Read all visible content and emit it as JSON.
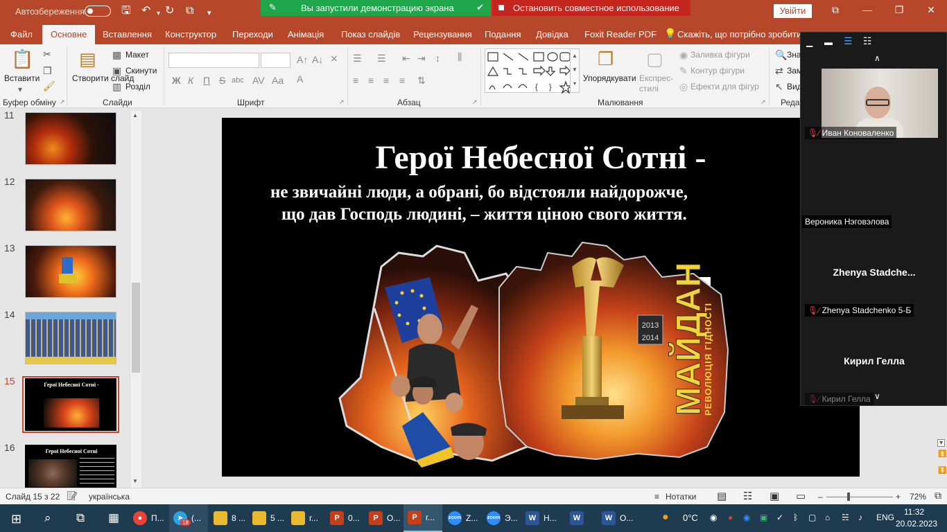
{
  "titlebar": {
    "autosave_label": "Автозбереження",
    "share_banner": "Вы запустили демонстрацию экрана",
    "stop_share": "Остановить совместное использование",
    "signin": "Увійти",
    "accent_color": "#b7472a"
  },
  "tabs": [
    "Файл",
    "Основне",
    "Вставлення",
    "Конструктор",
    "Переходи",
    "Анімація",
    "Показ слайдів",
    "Рецензування",
    "Подання",
    "Довідка",
    "Foxit Reader PDF",
    "Скажіть, що потрібно зробити"
  ],
  "ribbon": {
    "paste": "Вставити",
    "new_slide": "Створити слайд",
    "layout": "Макет",
    "reset": "Скинути",
    "section": "Розділ",
    "arrange": "Упорядкувати",
    "quick_styles": "Експрес-стилі",
    "shape_fill": "Заливка фігури",
    "shape_outline": "Контур фігури",
    "shape_effects": "Ефекти для фігур",
    "find": "Зна",
    "replace": "Зам",
    "select": "Вид",
    "groups": {
      "clipboard": "Буфер обміну",
      "slides": "Слайди",
      "font": "Шрифт",
      "paragraph": "Абзац",
      "drawing": "Малювання",
      "editing": "Реда"
    }
  },
  "thumbnails": [
    {
      "num": "11"
    },
    {
      "num": "12"
    },
    {
      "num": "13"
    },
    {
      "num": "14"
    },
    {
      "num": "15",
      "selected": true,
      "title": "Герої Небесної Сотні -"
    },
    {
      "num": "16",
      "title": "Герої Небесної Сотні"
    }
  ],
  "slide": {
    "title": "Герої Небесної Сотні -",
    "subtitle_line1": "не звичайні люди, а обрані, бо відстояли найдорожче,",
    "subtitle_line2": "що дав Господь людині, – життя ціною свого життя.",
    "logo_text": "МАЙДАН",
    "logo_sub": "РЕВОЛЮЦІЯ ГІДНОСТІ",
    "logo_years": "2013 2014"
  },
  "participants": [
    {
      "name": "Иван Коноваленко",
      "muted": true
    },
    {
      "name": "Вероника Нэговэлова",
      "muted": false
    },
    {
      "big": "Zhenya  Stadche...",
      "name": "Zhenya Stadchenko 5-Б",
      "muted": true
    },
    {
      "big": "Кирил Гелла",
      "name": "Кирил Гелла",
      "muted": true
    }
  ],
  "statusbar": {
    "slide_info": "Слайд 15 з 22",
    "language": "українська",
    "notes": "Нотатки",
    "zoom": "72%"
  },
  "taskbar": {
    "items": [
      {
        "label": "П...",
        "icon": "chrome-icon",
        "color": "#ea4335"
      },
      {
        "label": "(...",
        "icon": "telegram-icon",
        "color": "#2aa3e0",
        "badge": "18"
      },
      {
        "label": "8 ...",
        "icon": "folder-icon",
        "color": "#e8b931"
      },
      {
        "label": "5 ...",
        "icon": "folder-icon",
        "color": "#e8b931"
      },
      {
        "label": "г...",
        "icon": "folder-icon",
        "color": "#e8b931"
      },
      {
        "label": "0...",
        "icon": "powerpoint-icon",
        "color": "#c43e1c"
      },
      {
        "label": "О...",
        "icon": "powerpoint-icon",
        "color": "#c43e1c"
      },
      {
        "label": "г...",
        "icon": "powerpoint-icon",
        "color": "#c43e1c",
        "active": true
      },
      {
        "label": "Z...",
        "icon": "zoom-icon",
        "color": "#2d8cff"
      },
      {
        "label": "Э...",
        "icon": "zoom-icon",
        "color": "#2d8cff"
      },
      {
        "label": "Н...",
        "icon": "word-icon",
        "color": "#2b579a"
      },
      {
        "label": "",
        "icon": "word-icon",
        "color": "#2b579a"
      },
      {
        "label": "О...",
        "icon": "word-icon",
        "color": "#2b579a"
      }
    ],
    "weather": "0°C",
    "lang": "ENG",
    "time": "11:32",
    "date": "20.02.2023"
  }
}
